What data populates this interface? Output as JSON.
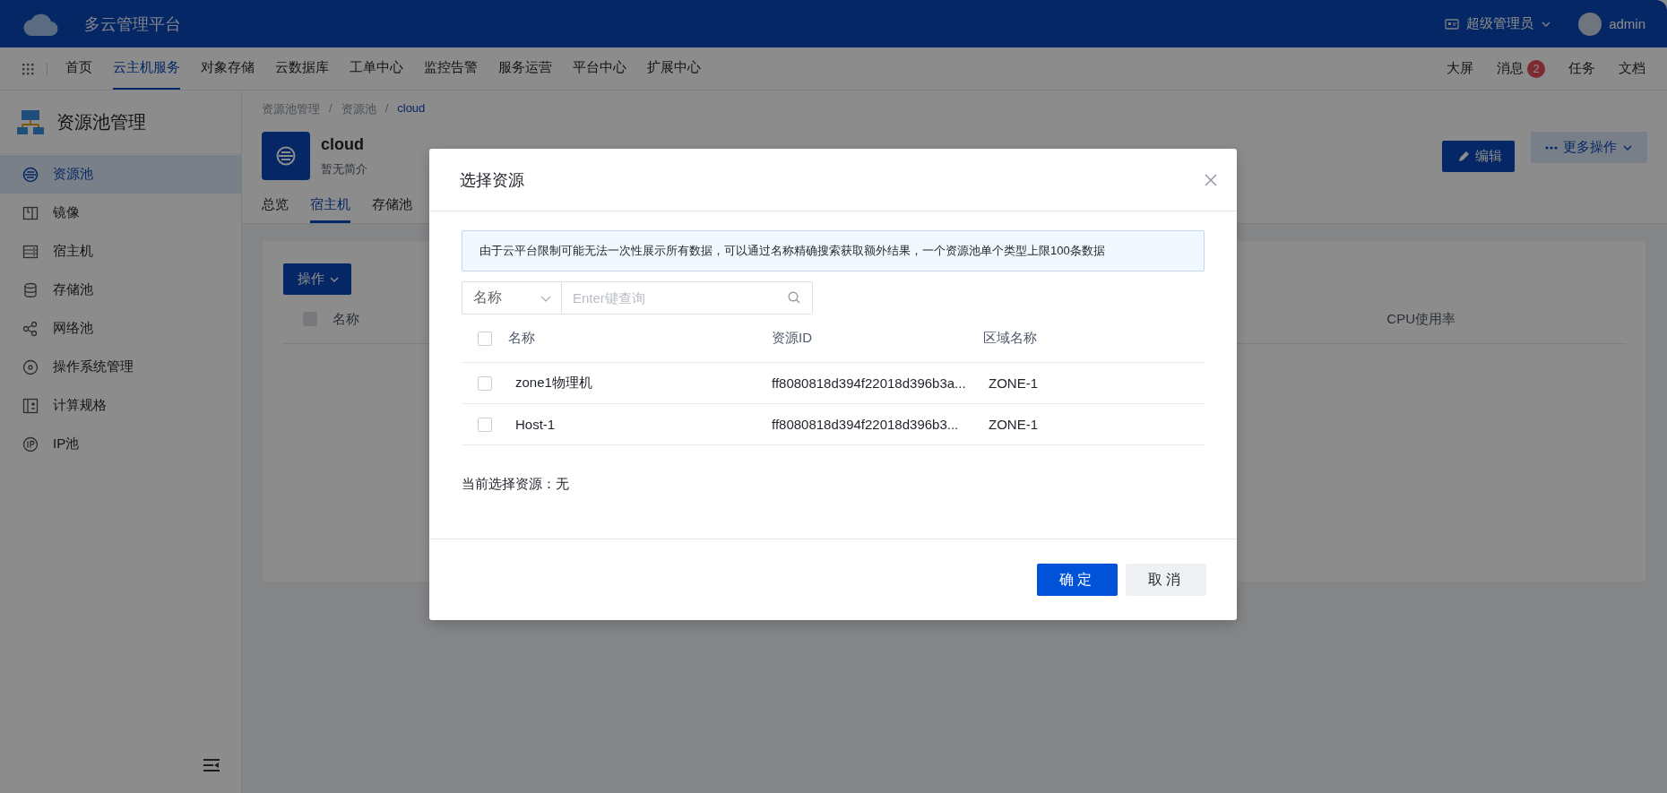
{
  "header": {
    "title": "多云管理平台",
    "role": "超级管理员",
    "user": "admin"
  },
  "nav": {
    "items": [
      {
        "label": "首页",
        "selected": false
      },
      {
        "label": "云主机服务",
        "selected": true
      },
      {
        "label": "对象存储",
        "selected": false
      },
      {
        "label": "云数据库",
        "selected": false
      },
      {
        "label": "工单中心",
        "selected": false
      },
      {
        "label": "监控告警",
        "selected": false
      },
      {
        "label": "服务运营",
        "selected": false
      },
      {
        "label": "平台中心",
        "selected": false
      },
      {
        "label": "扩展中心",
        "selected": false
      }
    ],
    "right": [
      {
        "label": "大屏"
      },
      {
        "label": "消息",
        "badge": "2"
      },
      {
        "label": "任务"
      },
      {
        "label": "文档"
      }
    ]
  },
  "sidebar": {
    "title": "资源池管理",
    "items": [
      {
        "label": "资源池",
        "selected": true
      },
      {
        "label": "镜像",
        "selected": false
      },
      {
        "label": "宿主机",
        "selected": false
      },
      {
        "label": "存储池",
        "selected": false
      },
      {
        "label": "网络池",
        "selected": false
      },
      {
        "label": "操作系统管理",
        "selected": false
      },
      {
        "label": "计算规格",
        "selected": false
      },
      {
        "label": "IP池",
        "selected": false
      }
    ]
  },
  "breadcrumb": {
    "separator": "/",
    "items": [
      "资源池管理",
      "资源池",
      "cloud"
    ]
  },
  "pool": {
    "name": "cloud",
    "description": "暂无简介"
  },
  "actions": [
    "编辑",
    "更多操作"
  ],
  "tabs": [
    {
      "label": "总览",
      "selected": false
    },
    {
      "label": "宿主机",
      "selected": true
    },
    {
      "label": "存储池",
      "selected": false
    }
  ],
  "host_table": {
    "action": "操作",
    "all_checked": false,
    "columns": [
      "名称",
      "CPU使用率"
    ]
  },
  "dialog": {
    "title": "选择资源",
    "notice": "由于云平台限制可能无法一次性展示所有数据，可以通过名称精确搜索获取额外结果，一个资源池单个类型上限100条数据",
    "filter": {
      "field": "名称",
      "placeholder": "Enter键查询"
    },
    "all_checked": false,
    "columns": [
      "名称",
      "资源ID",
      "区域名称"
    ],
    "rows": [
      {
        "name": "zone1物理机",
        "id": "ff8080818d394f22018d396b3a...",
        "zone": "ZONE-1",
        "checked": false
      },
      {
        "name": "Host-1",
        "id": "ff8080818d394f22018d396b3...",
        "zone": "ZONE-1",
        "checked": false
      }
    ],
    "selection": "当前选择资源：无",
    "buttons": [
      "确定",
      "取消"
    ]
  }
}
